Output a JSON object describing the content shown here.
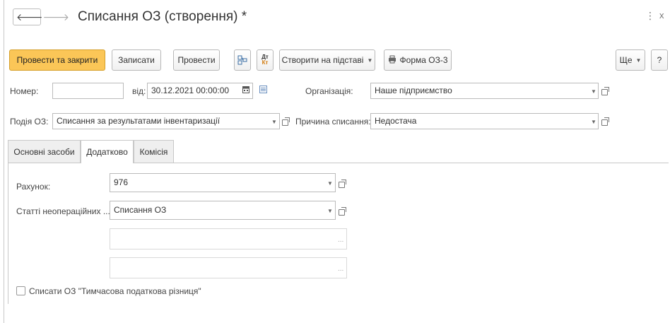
{
  "window": {
    "title": "Списання ОЗ (створення) *",
    "menu_icon": "more-vertical-icon",
    "close_label": "x"
  },
  "toolbar": {
    "post_close": "Провести та закрити",
    "save": "Записати",
    "post": "Провести",
    "dt_top": "Дт",
    "dt_bottom": "Кт",
    "create_based": "Створити на підставі",
    "print_form": "Форма ОЗ-3",
    "more": "Ще",
    "help": "?"
  },
  "header": {
    "number_label": "Номер:",
    "number_value": "",
    "date_label": "від:",
    "date_value": "30.12.2021 00:00:00",
    "org_label": "Організація:",
    "org_value": "Наше підприємство",
    "event_label": "Подія ОЗ:",
    "event_value": "Списання за результатами інвентаризації",
    "reason_label": "Причина списання:",
    "reason_value": "Недостача"
  },
  "tabs": [
    {
      "label": "Основні засоби"
    },
    {
      "label": "Додатково"
    },
    {
      "label": "Комісія"
    }
  ],
  "additional": {
    "account_label": "Рахунок:",
    "account_value": "976",
    "articles_label": "Статті неопераційних ...",
    "articles_value": "Списання ОЗ",
    "subconto1": "",
    "subconto2": "",
    "checkbox_label": "Списати ОЗ \"Тимчасова податкова різниця\"",
    "checkbox_checked": false
  },
  "colors": {
    "primary_button": "#fbc657",
    "border": "#bbbbbb"
  }
}
